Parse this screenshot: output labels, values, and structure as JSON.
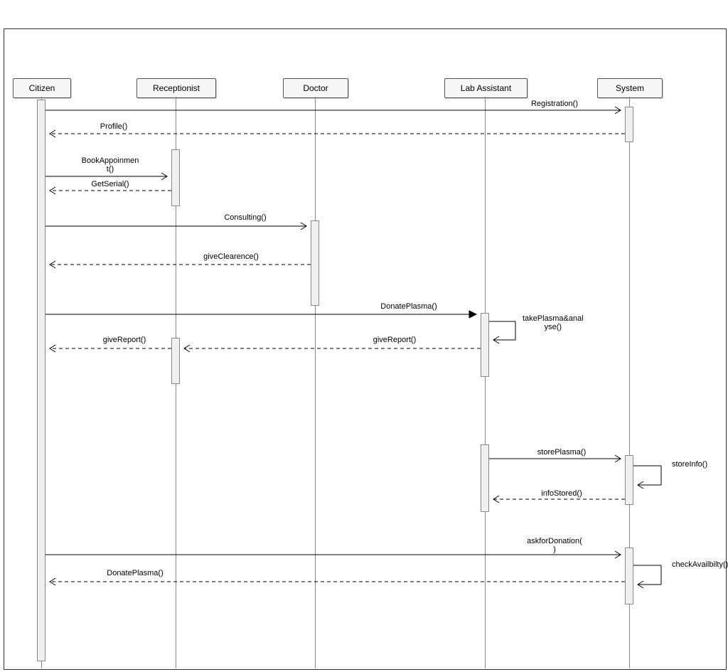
{
  "diagram": {
    "type": "uml-sequence",
    "participants": {
      "citizen": "Citizen",
      "receptionist": "Receptionist",
      "doctor": "Doctor",
      "lab": "Lab Assistant",
      "system": "System"
    },
    "messages": {
      "registration": "Registration()",
      "profile": "Profile()",
      "bookAppt": "BookAppoinmen\nt()",
      "getSerial": "GetSerial()",
      "consulting": "Consulting()",
      "giveClearence": "giveClearence()",
      "donatePlasma1": "DonatePlasma()",
      "takePlasma": "takePlasma&anal\nyse()",
      "giveReport1": "giveReport()",
      "giveReport2": "giveReport()",
      "storePlasma": "storePlasma()",
      "storeInfo": "storeInfo()",
      "infoStored": "infoStored()",
      "askForDonation": "askforDonation(\n)",
      "checkAvail": "checkAvailbilty()",
      "donatePlasma2": "DonatePlasma()"
    }
  }
}
